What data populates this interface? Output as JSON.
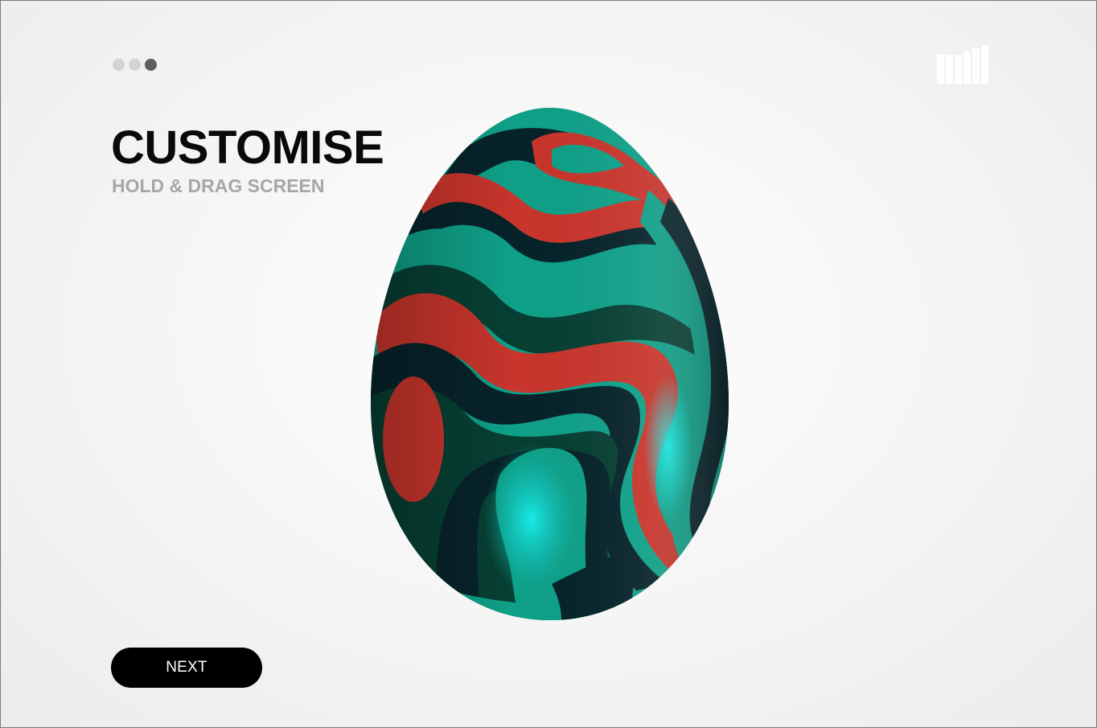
{
  "progress": {
    "steps": 3,
    "current": 3
  },
  "header": {
    "title": "CUSTOMISE",
    "subtitle": "HOLD & DRAG SCREEN"
  },
  "logo": {
    "icon": "bars-logo-icon"
  },
  "egg": {
    "icon": "patterned-egg-icon",
    "colors": {
      "teal": "#0fa088",
      "dark": "#06232a",
      "green": "#073f33",
      "red": "#c8352c",
      "highlight": "#19f2ee"
    }
  },
  "footer": {
    "next_label": "NEXT"
  }
}
